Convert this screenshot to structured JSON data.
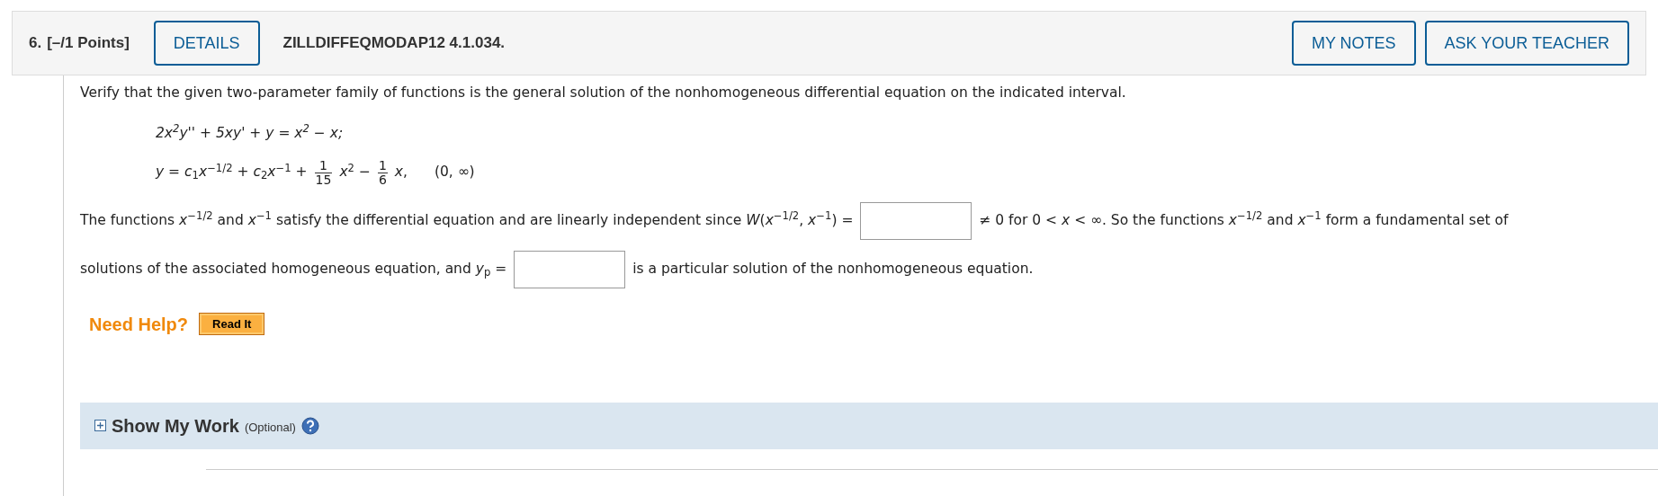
{
  "header": {
    "number": "6.",
    "points": "[–/1 Points]",
    "details_button": "DETAILS",
    "problem_id": "ZILLDIFFEQMODAP12 4.1.034.",
    "buttons": [
      "MY NOTES",
      "ASK YOUR TEACHER"
    ]
  },
  "intro": "Verify that the given two-parameter family of functions is the general solution of the nonhomogeneous differential equation on the indicated interval.",
  "equation": "2x$^{2}$y'' + 5xy' + y = x$^{2}$ − x;",
  "solution": [
    {
      "kind": "text",
      "text": "*y* = *c*$_{1}$*x*$^{−1/2}$ + *c*$_{2}$*x*$^{−1}$ +"
    },
    {
      "kind": "fraction",
      "numerator": "1",
      "denominator": "15"
    },
    {
      "kind": "text",
      "text": "*x*$^{2}$ −"
    },
    {
      "kind": "fraction",
      "numerator": "1",
      "denominator": "6"
    },
    {
      "kind": "text",
      "text": "*x*,"
    },
    {
      "kind": "interval",
      "text": "(0, ∞)"
    }
  ],
  "question_lines": [
    [
      {
        "kind": "text",
        "text": "The functions *x*$^{−1/2}$ and *x*$^{−1}$ satisfy the differential equation and are linearly independent since *W*(*x*$^{−1/2}$, *x*$^{−1}$) ="
      },
      {
        "kind": "input"
      },
      {
        "kind": "text",
        "text": "≠ 0 for 0 < *x* < ∞. So the functions *x*$^{−1/2}$ and *x*$^{−1}$ form a fundamental set of"
      }
    ],
    [
      {
        "kind": "text",
        "text": "solutions of the associated homogeneous equation, and *y*$_{p}$ ="
      },
      {
        "kind": "input"
      },
      {
        "kind": "text",
        "text": "is a particular solution of the nonhomogeneous equation."
      }
    ]
  ],
  "help": {
    "label": "Need Help?",
    "button": "Read It"
  },
  "show_work": {
    "title": "Show My Work",
    "note": "(Optional)",
    "expanded": false
  }
}
